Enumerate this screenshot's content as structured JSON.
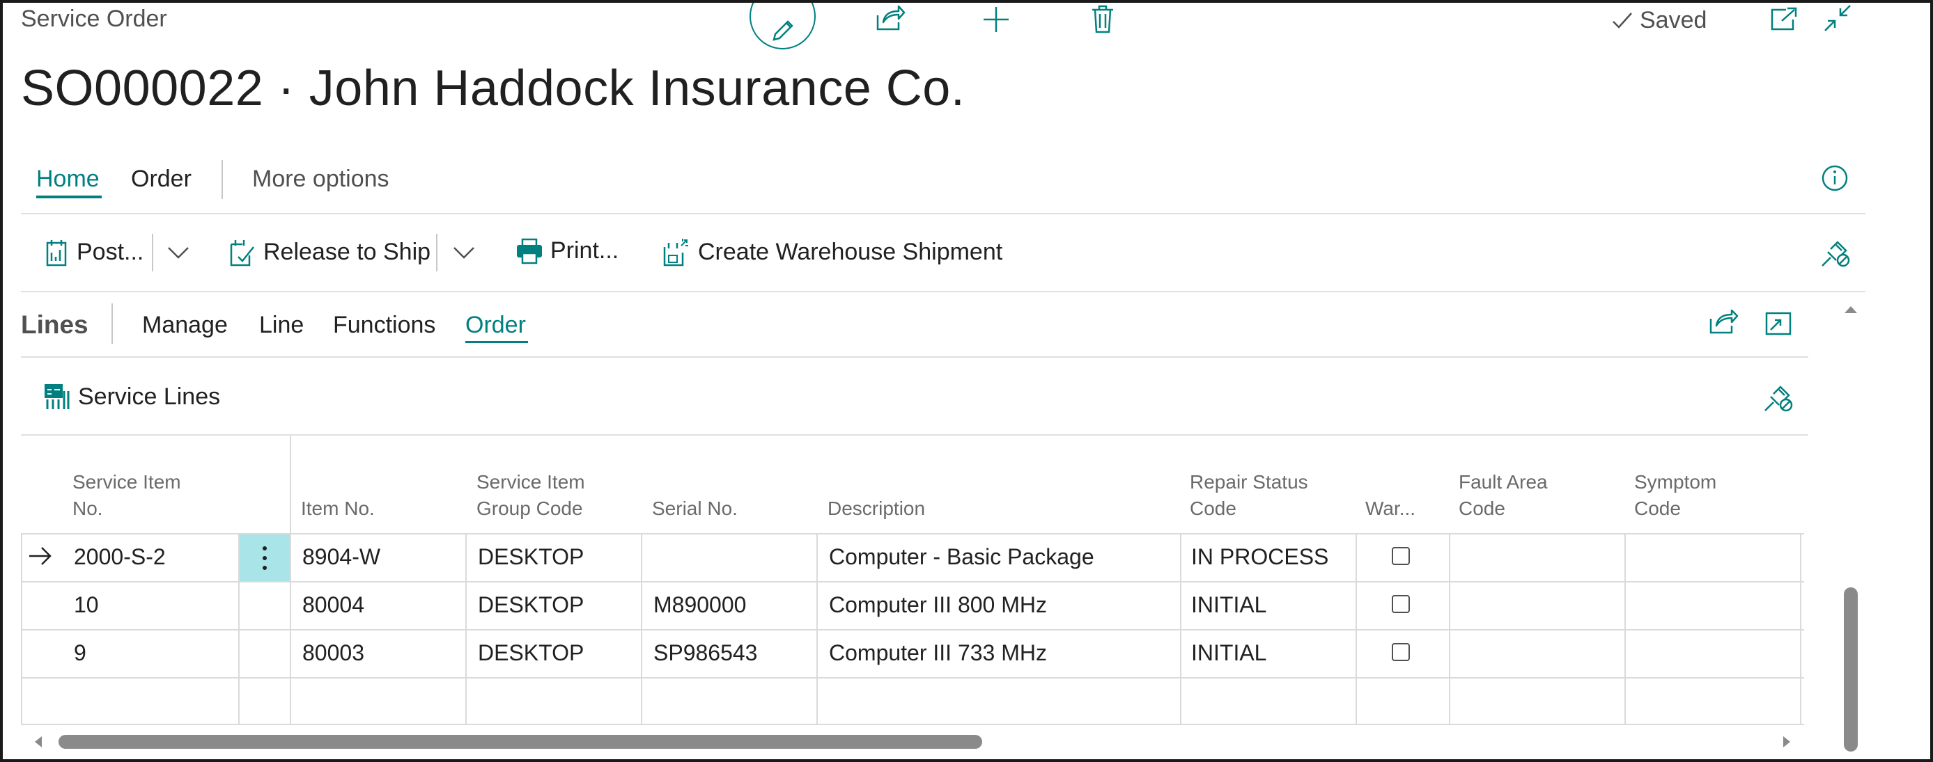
{
  "page": {
    "caption": "Service Order",
    "title": "SO000022 · John Haddock Insurance Co.",
    "saved_label": "Saved"
  },
  "header_actions": [
    {
      "icon": "pencil-icon"
    },
    {
      "icon": "share-icon"
    },
    {
      "icon": "plus-icon"
    },
    {
      "icon": "trash-icon"
    },
    {
      "icon": "open-in-new-window-icon"
    },
    {
      "icon": "collapse-icon"
    }
  ],
  "tabs": {
    "home": "Home",
    "order": "Order",
    "more": "More options",
    "active": "Home"
  },
  "actions": {
    "post": "Post...",
    "release": "Release to Ship",
    "print": "Print...",
    "create_shipment": "Create Warehouse Shipment"
  },
  "lines": {
    "title": "Lines",
    "tabs": [
      "Manage",
      "Line",
      "Functions",
      "Order"
    ],
    "active_tab": "Order",
    "service_lines": "Service Lines"
  },
  "grid": {
    "columns": [
      "Service Item No.",
      "Item No.",
      "Service Item Group Code",
      "Serial No.",
      "Description",
      "Repair Status Code",
      "War...",
      "Fault Area Code",
      "Symptom Code"
    ],
    "rows": [
      {
        "service_item_no": "2000-S-2",
        "item_no": "8904-W",
        "group_code": "DESKTOP",
        "serial_no": "",
        "description": "Computer - Basic Package",
        "repair_status": "IN PROCESS",
        "warranty": false,
        "selected": true
      },
      {
        "service_item_no": "10",
        "item_no": "80004",
        "group_code": "DESKTOP",
        "serial_no": "M890000",
        "description": "Computer III 800 MHz",
        "repair_status": "INITIAL",
        "warranty": false,
        "selected": false
      },
      {
        "service_item_no": "9",
        "item_no": "80003",
        "group_code": "DESKTOP",
        "serial_no": "SP986543",
        "description": "Computer III 733 MHz",
        "repair_status": "INITIAL",
        "warranty": false,
        "selected": false
      }
    ]
  },
  "colors": {
    "accent": "#00807f",
    "selected_cell": "#a9e4e9"
  }
}
